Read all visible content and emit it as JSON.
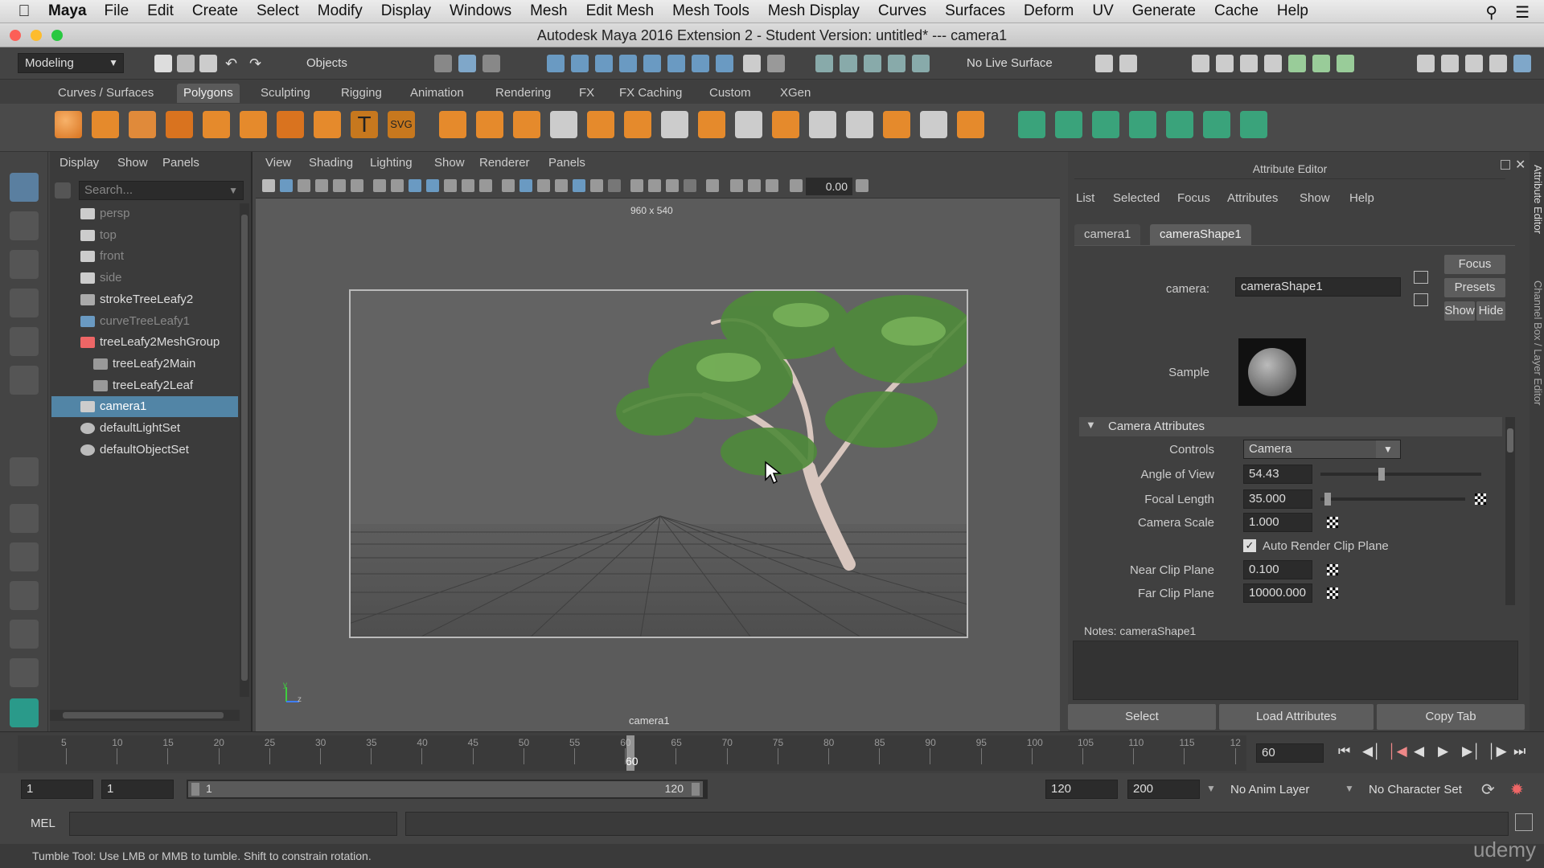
{
  "menubar": {
    "app": "Maya",
    "items": [
      "File",
      "Edit",
      "Create",
      "Select",
      "Modify",
      "Display",
      "Windows",
      "Mesh",
      "Edit Mesh",
      "Mesh Tools",
      "Mesh Display",
      "Curves",
      "Surfaces",
      "Deform",
      "UV",
      "Generate",
      "Cache",
      "Help"
    ]
  },
  "window": {
    "title": "Autodesk Maya 2016 Extension 2 - Student Version: untitled*   ---   camera1"
  },
  "statusline": {
    "mode": "Modeling",
    "selection_mask": "Objects",
    "live_surface": "No Live Surface"
  },
  "shelf": {
    "tabs": [
      "Curves / Surfaces",
      "Polygons",
      "Sculpting",
      "Rigging",
      "Animation",
      "Rendering",
      "FX",
      "FX Caching",
      "Custom",
      "XGen"
    ],
    "active_tab": "Polygons"
  },
  "outliner": {
    "menus": [
      "Display",
      "Show",
      "Panels"
    ],
    "search_placeholder": "Search...",
    "items": [
      {
        "label": "persp",
        "type": "camera",
        "dim": true
      },
      {
        "label": "top",
        "type": "camera",
        "dim": true
      },
      {
        "label": "front",
        "type": "camera",
        "dim": true
      },
      {
        "label": "side",
        "type": "camera",
        "dim": true
      },
      {
        "label": "strokeTreeLeafy2",
        "type": "stroke",
        "dim": false
      },
      {
        "label": "curveTreeLeafy1",
        "type": "curve",
        "dim": true
      },
      {
        "label": "treeLeafy2MeshGroup",
        "type": "group",
        "dim": false
      },
      {
        "label": "treeLeafy2Main",
        "type": "mesh",
        "dim": false
      },
      {
        "label": "treeLeafy2Leaf",
        "type": "mesh",
        "dim": false
      },
      {
        "label": "camera1",
        "type": "camera",
        "dim": false,
        "selected": true
      },
      {
        "label": "defaultLightSet",
        "type": "set",
        "dim": false
      },
      {
        "label": "defaultObjectSet",
        "type": "set",
        "dim": false
      }
    ]
  },
  "viewport": {
    "menus": [
      "View",
      "Shading",
      "Lighting",
      "Show",
      "Renderer",
      "Panels"
    ],
    "value_field": "0.00",
    "resolution": "960 x 540",
    "camera_label": "camera1",
    "axis_y": "y",
    "axis_z": "z"
  },
  "attribute_editor": {
    "title": "Attribute Editor",
    "menus": [
      "List",
      "Selected",
      "Focus",
      "Attributes",
      "Show",
      "Help"
    ],
    "tabs": [
      "camera1",
      "cameraShape1"
    ],
    "active_tab": "cameraShape1",
    "camera_label": "camera:",
    "camera_value": "cameraShape1",
    "buttons": {
      "focus": "Focus",
      "presets": "Presets",
      "show": "Show",
      "hide": "Hide"
    },
    "sample_label": "Sample",
    "section": "Camera Attributes",
    "controls_label": "Controls",
    "controls_value": "Camera",
    "angle_label": "Angle of View",
    "angle_value": "54.43",
    "angle_fraction": 0.36,
    "focal_label": "Focal Length",
    "focal_value": "35.000",
    "focal_fraction": 0.03,
    "scale_label": "Camera Scale",
    "scale_value": "1.000",
    "auto_clip_label": "Auto Render Clip Plane",
    "auto_clip_checked": true,
    "near_label": "Near Clip Plane",
    "near_value": "0.100",
    "far_label": "Far Clip Plane",
    "far_value": "10000.000",
    "notes_label": "Notes:  cameraShape1",
    "bottom_buttons": [
      "Select",
      "Load Attributes",
      "Copy Tab"
    ],
    "side_tabs": [
      "Attribute Editor",
      "Channel Box / Layer Editor"
    ]
  },
  "timeline": {
    "ticks": [
      5,
      10,
      15,
      20,
      25,
      30,
      35,
      40,
      45,
      50,
      55,
      60,
      65,
      70,
      75,
      80,
      85,
      90,
      95,
      100,
      105,
      110,
      115,
      12
    ],
    "current_frame": "60",
    "current_field": "60"
  },
  "range": {
    "start": "1",
    "playback_start": "1",
    "slider_start": "1",
    "slider_end": "120",
    "playback_end": "120",
    "end": "200",
    "anim_layer": "No Anim Layer",
    "character_set": "No Character Set"
  },
  "cmdline": {
    "label": "MEL"
  },
  "helpline": {
    "text": "Tumble Tool: Use LMB or MMB to tumble. Shift to constrain rotation."
  },
  "watermark": "udemy",
  "colors": {
    "selection": "#5285a6",
    "bg": "#444444",
    "viewport": "#5b5b5b",
    "timeline_cursor": "#d0d0d0"
  }
}
